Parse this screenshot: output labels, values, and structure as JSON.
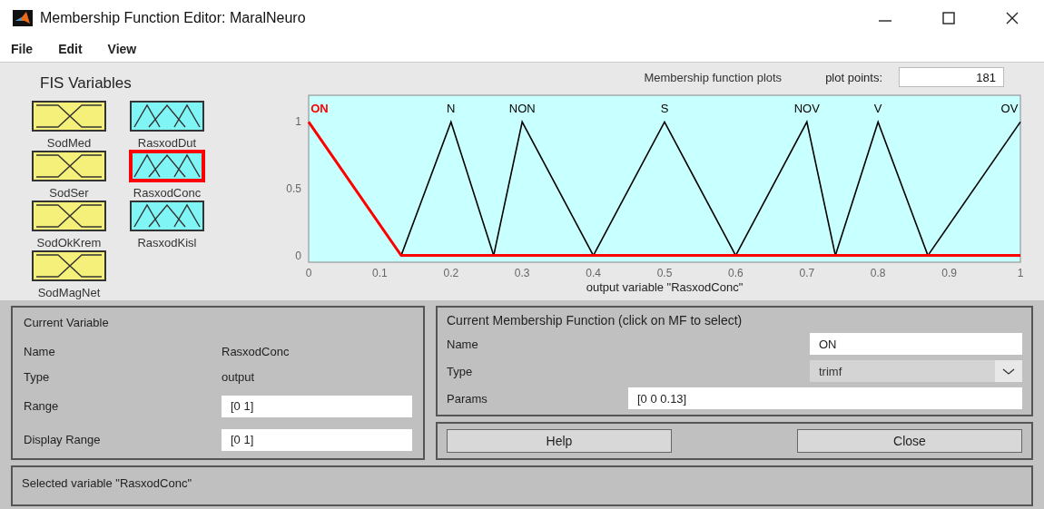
{
  "window": {
    "title": "Membership Function Editor: MaralNeuro"
  },
  "menu": [
    "File",
    "Edit",
    "View"
  ],
  "fis_variables": {
    "title": "FIS Variables",
    "items": [
      {
        "name": "SodMed",
        "kind": "input",
        "selected": false
      },
      {
        "name": "RasxodDut",
        "kind": "output",
        "selected": false
      },
      {
        "name": "SodSer",
        "kind": "input",
        "selected": false
      },
      {
        "name": "RasxodConc",
        "kind": "output",
        "selected": true
      },
      {
        "name": "SodOkKrem",
        "kind": "input",
        "selected": false
      },
      {
        "name": "RasxodKisl",
        "kind": "output",
        "selected": false
      },
      {
        "name": "SodMagNet",
        "kind": "input",
        "selected": false
      }
    ]
  },
  "plot": {
    "plot_points_label": "plot points:",
    "plot_points": "181",
    "chart_data": {
      "type": "line",
      "title": "Membership function plots",
      "xlabel": "output variable \"RasxodConc\"",
      "x": [
        0,
        0.13,
        0.2,
        0.26,
        0.3,
        0.4,
        0.5,
        0.6,
        0.7,
        0.74,
        0.8,
        0.87,
        1
      ],
      "series": [
        {
          "name": "ON",
          "color": "#ff0000",
          "values": [
            1,
            0,
            0,
            0,
            0,
            0,
            0,
            0,
            0,
            0,
            0,
            0,
            0
          ]
        },
        {
          "name": "N",
          "color": "#000000",
          "values": [
            null,
            0,
            1,
            0,
            null,
            null,
            null,
            null,
            null,
            null,
            null,
            null,
            null
          ]
        },
        {
          "name": "NON",
          "color": "#000000",
          "values": [
            null,
            null,
            null,
            0,
            1,
            0,
            null,
            null,
            null,
            null,
            null,
            null,
            null
          ]
        },
        {
          "name": "S",
          "color": "#000000",
          "values": [
            null,
            null,
            null,
            null,
            null,
            0,
            1,
            0,
            null,
            null,
            null,
            null,
            null
          ]
        },
        {
          "name": "NOV",
          "color": "#000000",
          "values": [
            null,
            null,
            null,
            null,
            null,
            null,
            null,
            0,
            1,
            0,
            null,
            null,
            null
          ]
        },
        {
          "name": "V",
          "color": "#000000",
          "values": [
            null,
            null,
            null,
            null,
            null,
            null,
            null,
            null,
            null,
            0,
            1,
            0,
            null
          ]
        },
        {
          "name": "OV",
          "color": "#000000",
          "values": [
            null,
            null,
            null,
            null,
            null,
            null,
            null,
            null,
            null,
            null,
            null,
            0,
            1
          ]
        }
      ],
      "xlim": [
        0,
        1
      ],
      "ylim": [
        -0.05,
        1.2
      ],
      "xticks": [
        0,
        0.1,
        0.2,
        0.3,
        0.4,
        0.5,
        0.6,
        0.7,
        0.8,
        0.9,
        1
      ],
      "yticks": [
        0,
        0.5,
        1
      ]
    }
  },
  "current_variable": {
    "title": "Current Variable",
    "name_label": "Name",
    "name": "RasxodConc",
    "type_label": "Type",
    "type": "output",
    "range_label": "Range",
    "range": "[0 1]",
    "display_range_label": "Display Range",
    "display_range": "[0 1]"
  },
  "current_mf": {
    "title": "Current Membership Function (click on MF to select)",
    "name_label": "Name",
    "name": "ON",
    "type_label": "Type",
    "type": "trimf",
    "params_label": "Params",
    "params": "[0 0 0.13]"
  },
  "buttons": [
    "Help",
    "Close"
  ],
  "status_bar": "Selected variable \"RasxodConc\""
}
